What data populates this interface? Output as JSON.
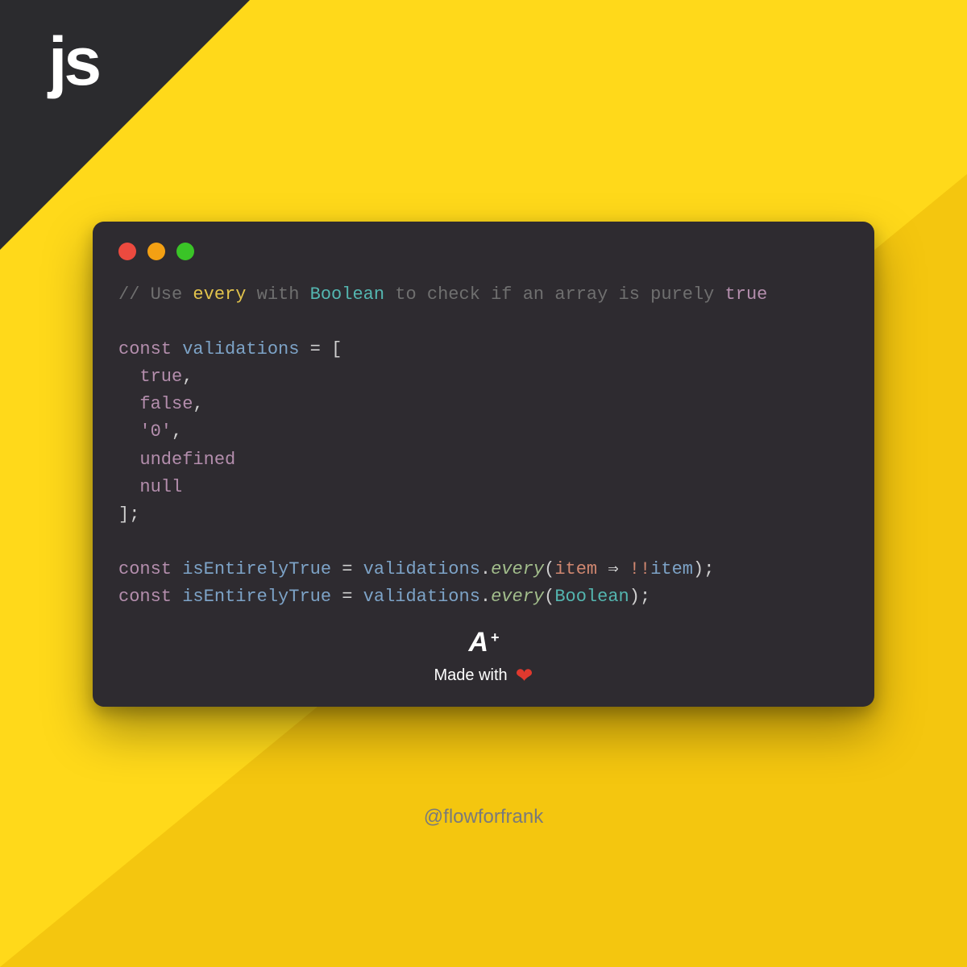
{
  "corner": {
    "label": "js"
  },
  "colors": {
    "bg_light": "#f4c60f",
    "bg_bright": "#ffd91a",
    "corner": "#2b2b2e",
    "window": "#2e2b30",
    "dot_red": "#ec4a3f",
    "dot_yellow": "#f3a013",
    "dot_green": "#3ac427"
  },
  "code": {
    "comment_prefix": "// Use ",
    "comment_every": "every",
    "comment_with": " with ",
    "comment_boolean": "Boolean",
    "comment_mid": " to check if an array is purely ",
    "comment_true": "true",
    "kw_const": "const",
    "id_validations": "validations",
    "eq": " = ",
    "lbracket": "[",
    "rbracket_semi": "];",
    "indent": "  ",
    "items": {
      "true": "true",
      "false": "false",
      "zero": "'0'",
      "undefined": "undefined",
      "null": "null"
    },
    "comma": ",",
    "id_isEntirelyTrue": "isEntirelyTrue",
    "dot": ".",
    "fn_every": "every",
    "lparen": "(",
    "rparen_semi": ");",
    "id_item": "item",
    "arrow": " ⇒ ",
    "bangbang": "!!",
    "id_Boolean": "Boolean"
  },
  "badge": {
    "a": "A",
    "plus": "+",
    "made_prefix": "Made with",
    "heart": "❤"
  },
  "handle": "@flowforfrank"
}
